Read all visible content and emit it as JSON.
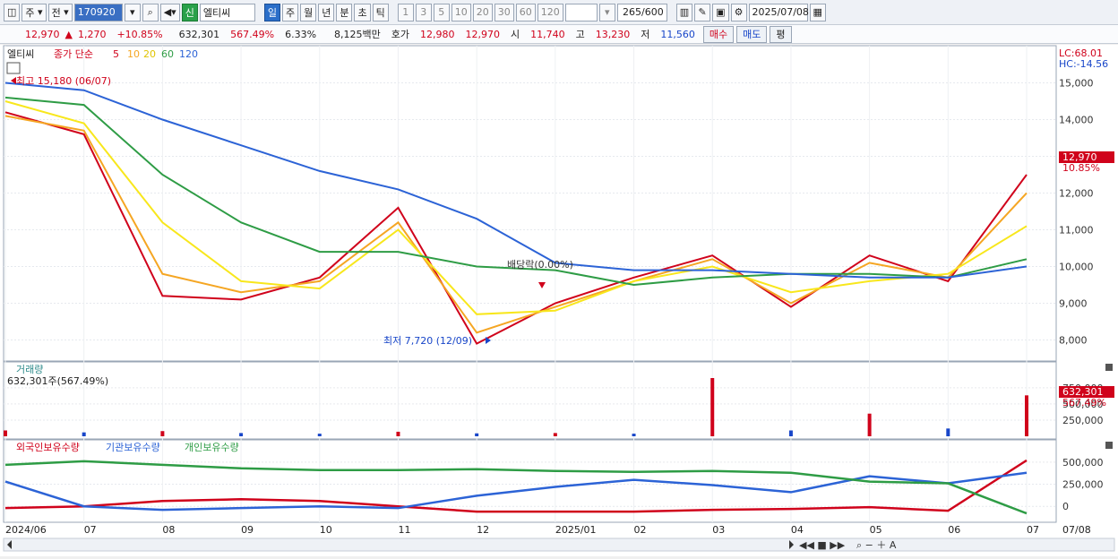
{
  "toolbar": {
    "period_select": "주",
    "prev_btn": "전",
    "stock_code": "170920",
    "new_badge": "신",
    "stock_name": "엘티씨",
    "period_tabs": [
      "일",
      "주",
      "월",
      "년",
      "분",
      "초",
      "틱"
    ],
    "interval_tabs": [
      "1",
      "3",
      "5",
      "10",
      "20",
      "30",
      "60",
      "120"
    ],
    "count_value": "265",
    "count_max": "/600",
    "date_value": "2025/07/08"
  },
  "quote": {
    "price": "12,970",
    "change_arrow": "▲",
    "change": "1,270",
    "change_pct": "+10.85%",
    "volume": "632,301",
    "volume_pct": "567.49%",
    "turnover": "6.33%",
    "amount": "8,125백만",
    "ask_label": "호가",
    "ask1": "12,980",
    "ask2": "12,970",
    "open_label": "시",
    "open": "11,740",
    "high_label": "고",
    "high": "13,230",
    "low_label": "저",
    "low": "11,560",
    "buy_btn": "매수",
    "sell_btn": "매도",
    "eval_btn": "평"
  },
  "price_panel": {
    "legend_name": "엘티씨",
    "legend_ma_label": "종가 단순",
    "ma_periods": [
      "5",
      "10",
      "20",
      "60",
      "120"
    ],
    "ma_colors": [
      "#d0021b",
      "#f5a623",
      "#f8e71c",
      "#2e9c45",
      "#2c63d6"
    ],
    "lc_text": "LC:68.01",
    "hc_text": "HC:-14.56",
    "high_annot": "최고 15,180 (06/07)",
    "low_annot": "최저 7,720 (12/09)",
    "dividend_annot": "배당락(0.00%)",
    "last_price": "12,970",
    "last_pct": "10.85%",
    "y_ticks": [
      "15,000",
      "14,000",
      "13,000",
      "12,000",
      "11,000",
      "10,000",
      "9,000",
      "8,000"
    ]
  },
  "volume_panel": {
    "title": "거래량",
    "value_text": "632,301주(567.49%)",
    "last_value": "632,301",
    "last_pct": "567.49%",
    "y_ticks": [
      "750,000",
      "500,000",
      "250,000"
    ]
  },
  "holding_panel": {
    "legend": [
      "외국인보유수량",
      "기관보유수량",
      "개인보유수량"
    ],
    "legend_colors": [
      "#d0021b",
      "#2c63d6",
      "#2e9c45"
    ],
    "y_ticks": [
      "500,000",
      "250,000",
      "0"
    ]
  },
  "x_axis": {
    "labels": [
      "2024/06",
      "07",
      "08",
      "09",
      "10",
      "11",
      "12",
      "2025/01",
      "02",
      "03",
      "04",
      "05",
      "06",
      "07",
      "07/08"
    ]
  },
  "chart_data": [
    {
      "type": "line",
      "title": "엘티씨",
      "x": [
        "2024/06",
        "07",
        "08",
        "09",
        "10",
        "11",
        "12",
        "2025/01",
        "02",
        "03",
        "04",
        "05",
        "06",
        "07"
      ],
      "series": [
        {
          "name": "5",
          "values": [
            14200,
            13600,
            9200,
            9100,
            9700,
            11600,
            7900,
            9000,
            9700,
            10300,
            8900,
            10300,
            9600,
            12500
          ]
        },
        {
          "name": "10",
          "values": [
            14100,
            13700,
            9800,
            9300,
            9600,
            11200,
            8200,
            8900,
            9600,
            10200,
            9000,
            10100,
            9700,
            12000
          ]
        },
        {
          "name": "20",
          "values": [
            14500,
            13900,
            11200,
            9600,
            9400,
            11000,
            8700,
            8800,
            9600,
            10000,
            9300,
            9600,
            9800,
            11100
          ]
        },
        {
          "name": "60",
          "values": [
            14600,
            14400,
            12500,
            11200,
            10400,
            10400,
            10000,
            9900,
            9500,
            9700,
            9800,
            9800,
            9700,
            10200
          ]
        },
        {
          "name": "120",
          "values": [
            15000,
            14800,
            14000,
            13300,
            12600,
            12100,
            11300,
            10100,
            9900,
            9900,
            9800,
            9700,
            9700,
            10000
          ]
        }
      ],
      "ylim": [
        7500,
        15500
      ]
    },
    {
      "type": "bar",
      "title": "거래량",
      "x": [
        "2024/06",
        "07",
        "08",
        "09",
        "10",
        "11",
        "12",
        "2025/01",
        "02",
        "03",
        "04",
        "05",
        "06",
        "07"
      ],
      "values": [
        90000,
        60000,
        80000,
        50000,
        40000,
        70000,
        45000,
        50000,
        40000,
        900000,
        90000,
        350000,
        120000,
        632301
      ],
      "ylim": [
        0,
        900000
      ]
    },
    {
      "type": "line",
      "title": "외국인보유수량",
      "x": [
        "2024/06",
        "07",
        "08",
        "09",
        "10",
        "11",
        "12",
        "2025/01",
        "02",
        "03",
        "04",
        "05",
        "06",
        "07"
      ],
      "series": [
        {
          "name": "외국인보유수량",
          "values": [
            -20000,
            0,
            60000,
            80000,
            60000,
            0,
            -60000,
            -60000,
            -60000,
            -40000,
            -30000,
            -10000,
            -50000,
            520000
          ]
        },
        {
          "name": "기관보유수량",
          "values": [
            280000,
            0,
            -40000,
            -20000,
            0,
            -20000,
            120000,
            220000,
            300000,
            240000,
            160000,
            340000,
            260000,
            380000
          ]
        },
        {
          "name": "개인보유수량",
          "values": [
            470000,
            510000,
            470000,
            430000,
            410000,
            410000,
            420000,
            400000,
            390000,
            400000,
            380000,
            280000,
            260000,
            -80000
          ]
        }
      ],
      "ylim": [
        -150000,
        600000
      ]
    }
  ]
}
